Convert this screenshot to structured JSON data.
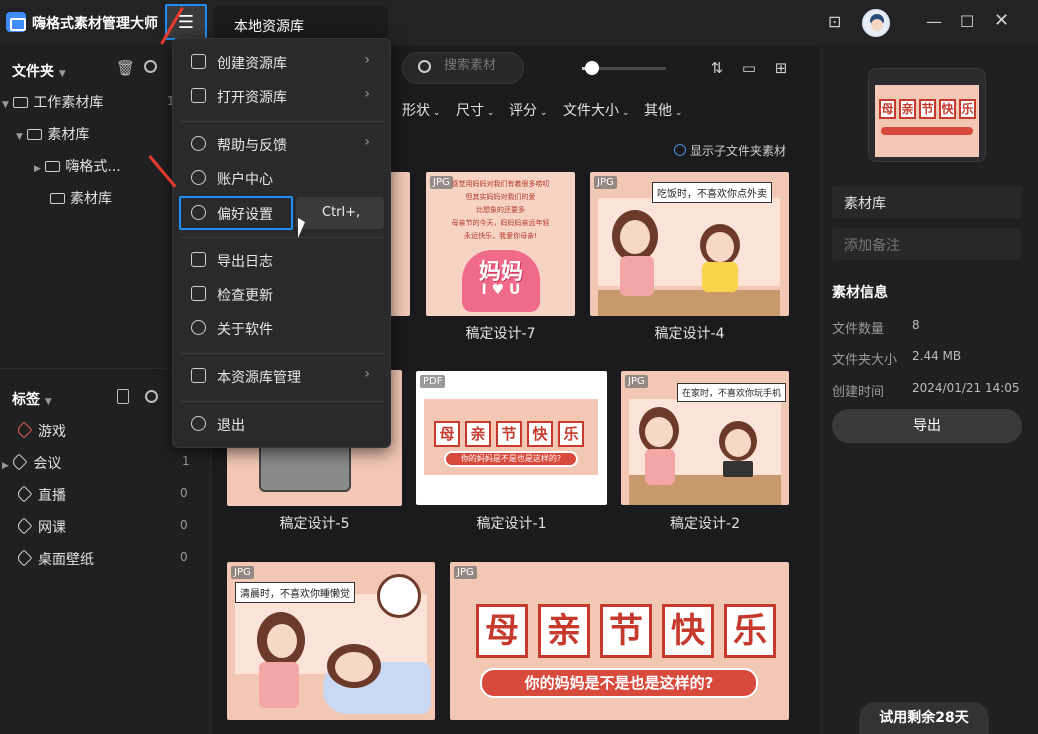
{
  "app": {
    "title": "嗨格式素材管理大师",
    "tab_label": "本地资源库"
  },
  "colors": {
    "accent": "#1f8df5",
    "bg": "#1b1b1d",
    "panel": "#202022",
    "annotation": "#e53b2c"
  },
  "sidebar": {
    "folders_title": "文件夹",
    "tree": [
      {
        "label": "工作素材库",
        "count": "1"
      },
      {
        "label": "素材库"
      },
      {
        "label": "嗨格式..."
      },
      {
        "label": "素材库"
      }
    ],
    "tags_title": "标签",
    "tags": [
      {
        "label": "游戏",
        "count": ""
      },
      {
        "label": "会议",
        "count": "1"
      },
      {
        "label": "直播",
        "count": "0"
      },
      {
        "label": "网课",
        "count": "0"
      },
      {
        "label": "桌面壁纸",
        "count": "0"
      }
    ]
  },
  "menu": {
    "items": [
      {
        "label": "创建资源库",
        "icon": "cube-icon",
        "submenu": true
      },
      {
        "label": "打开资源库",
        "icon": "cube-open-icon",
        "submenu": true
      },
      {
        "label": "帮助与反馈",
        "icon": "help-icon",
        "submenu": true
      },
      {
        "label": "账户中心",
        "icon": "user-icon",
        "submenu": false
      },
      {
        "label": "偏好设置",
        "icon": "settings-icon",
        "submenu": false,
        "shortcut": "Ctrl+,"
      },
      {
        "label": "导出日志",
        "icon": "calendar-icon",
        "submenu": false
      },
      {
        "label": "检查更新",
        "icon": "update-icon",
        "submenu": false
      },
      {
        "label": "关于软件",
        "icon": "info-icon",
        "submenu": false
      },
      {
        "label": "本资源库管理",
        "icon": "cube-manage-icon",
        "submenu": true
      },
      {
        "label": "退出",
        "icon": "exit-icon",
        "submenu": false
      }
    ]
  },
  "toolbar": {
    "search_placeholder": "搜索素材",
    "filters": [
      "形状",
      "尺寸",
      "评分",
      "文件大小",
      "其他"
    ],
    "show_subfolder": "显示子文件夹素材"
  },
  "cards": [
    {
      "label": "稿定设计-7",
      "type": "JPG"
    },
    {
      "label": "稿定设计-4",
      "type": "JPG",
      "caption": "吃饭时，不喜欢你点外卖"
    },
    {
      "label": "稿定设计-5",
      "type": ""
    },
    {
      "label": "稿定设计-1",
      "type": "PDF",
      "title_chars": [
        "母",
        "亲",
        "节",
        "快",
        "乐"
      ],
      "subtitle": "你的妈妈是不是也是这样的?"
    },
    {
      "label": "稿定设计-2",
      "type": "JPG",
      "caption": "在家时，不喜欢你玩手机"
    },
    {
      "label": "",
      "type": "JPG",
      "caption": "清晨时，不喜欢你睡懒觉"
    },
    {
      "label": "",
      "type": "JPG",
      "title_chars": [
        "母",
        "亲",
        "节",
        "快",
        "乐"
      ],
      "subtitle": "你的妈妈是不是也是这样的?"
    }
  ],
  "poster7": {
    "lines": [
      "感觉用妈妈对我们有着很多唠叨",
      "但其实妈妈对我们的爱",
      "比想象的还要多",
      "母亲节的今天，妈妈妈亲远年轻",
      "永远快乐，我爱你母亲!"
    ],
    "big": "妈妈",
    "love": "I ♥ U"
  },
  "right_panel": {
    "folder_name": "素材库",
    "note_placeholder": "添加备注",
    "info_title": "素材信息",
    "info": [
      {
        "label": "文件数量",
        "value": "8"
      },
      {
        "label": "文件夹大小",
        "value": "2.44 MB"
      },
      {
        "label": "创建时间",
        "value": "2024/01/21 14:05"
      }
    ],
    "export_label": "导出",
    "trial_label": "试用剩余28天"
  }
}
